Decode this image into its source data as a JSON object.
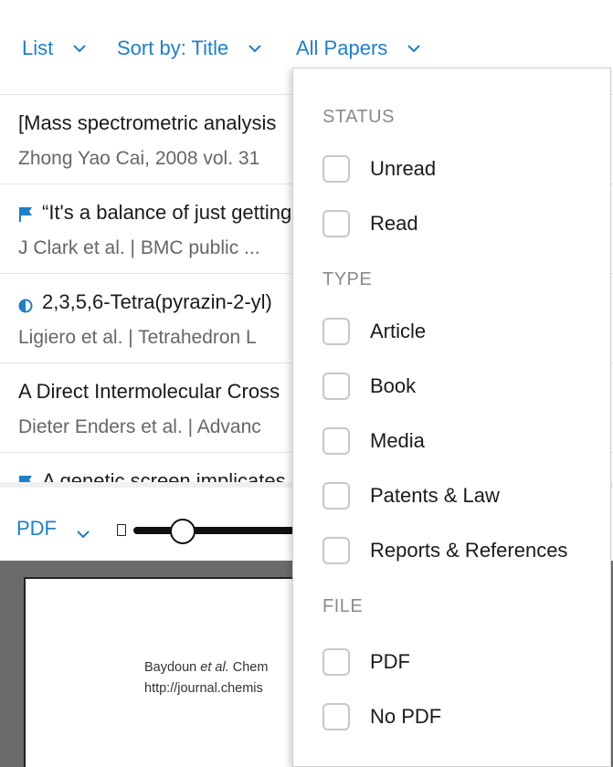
{
  "toolbar": {
    "view_label": "List",
    "sort_label": "Sort by: Title",
    "filter_label": "All Papers"
  },
  "papers": [
    {
      "title": "[Mass spectrometric analysis",
      "meta": "Zhong Yao Cai, 2008 vol. 31",
      "marker": "none"
    },
    {
      "title": "“It's a balance of just getting",
      "meta": "J Clark et al. | BMC public  ...",
      "marker": "flag-icon"
    },
    {
      "title": "2,3,5,6-Tetra(pyrazin-2-yl)",
      "meta": "Ligiero et al. | Tetrahedron L",
      "marker": "half-circle-icon"
    },
    {
      "title": "A Direct Intermolecular Cross",
      "meta": "Dieter Enders et al. | Advanc",
      "marker": "none"
    },
    {
      "title": "A genetic screen implicates",
      "meta": "",
      "marker": "flag-icon"
    }
  ],
  "pdf_bar": {
    "format_label": "PDF",
    "zoom_level": 0.3
  },
  "viewer": {
    "line1_author": "Baydoun ",
    "line1_etal": "et al.",
    "line1_journal": " Chem",
    "line2": "http://journal.chemis"
  },
  "filter_menu": {
    "status_heading": "STATUS",
    "status_options": [
      "Unread",
      "Read"
    ],
    "type_heading": "TYPE",
    "type_options": [
      "Article",
      "Book",
      "Media",
      "Patents & Law",
      "Reports & References"
    ],
    "file_heading": "FILE",
    "file_options": [
      "PDF",
      "No PDF"
    ]
  },
  "colors": {
    "accent": "#1f7fc6",
    "viewer_bg": "#6b6b6b"
  }
}
